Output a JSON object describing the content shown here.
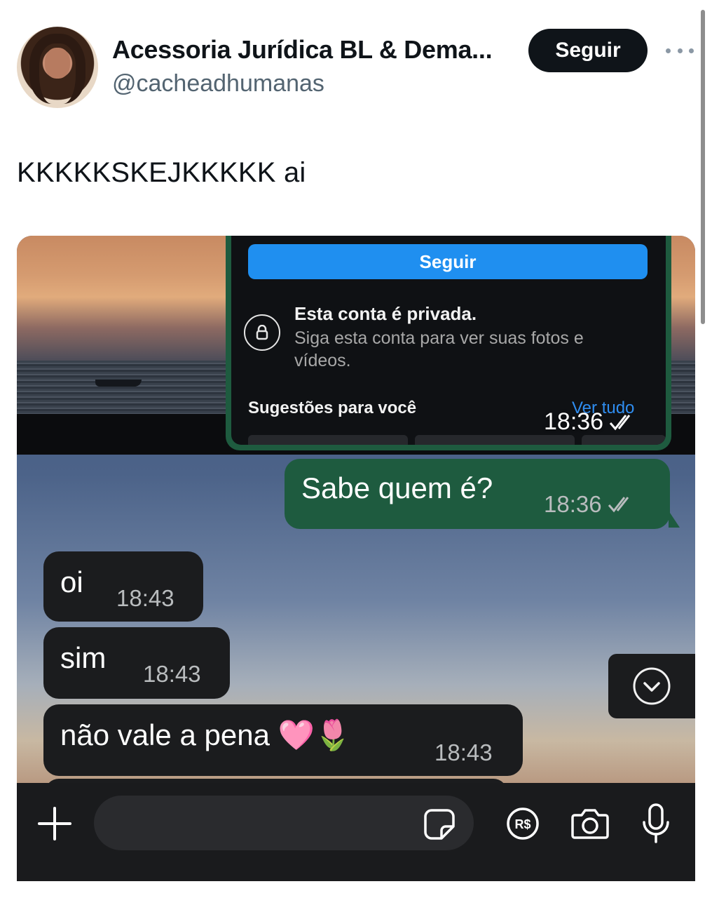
{
  "tweet": {
    "display_name": "Acessoria Jurídica BL & Dema...",
    "handle": "@cacheadhumanas",
    "follow_label": "Seguir",
    "text": "KKKKKSKEJKKKKK ai"
  },
  "chat": {
    "forwarded_image": {
      "follow_label": "Seguir",
      "private_title": "Esta conta é privada.",
      "private_desc": "Siga esta conta para ver suas fotos e vídeos.",
      "suggestions_label": "Sugestões para você",
      "see_all_label": "Ver tudo",
      "time": "18:36"
    },
    "messages": [
      {
        "direction": "out",
        "text": "Sabe quem é?",
        "time": "18:36",
        "status": "read"
      },
      {
        "direction": "in",
        "text": "oi",
        "time": "18:43"
      },
      {
        "direction": "in",
        "text": "sim",
        "time": "18:43"
      },
      {
        "direction": "in",
        "text": "não vale a pena 🩷🌷",
        "time": "18:43"
      }
    ]
  },
  "colors": {
    "outgoing_bubble": "#1e5b3f",
    "incoming_bubble": "#1b1c1e",
    "follow_button": "#0f1419",
    "ig_follow_button": "#1f8ff0",
    "link_blue": "#2f8df0"
  },
  "icons": [
    "more-icon",
    "lock-icon",
    "double-check-icon",
    "chevron-down-icon",
    "plus-icon",
    "sticker-icon",
    "payment-icon",
    "camera-icon",
    "microphone-icon"
  ]
}
